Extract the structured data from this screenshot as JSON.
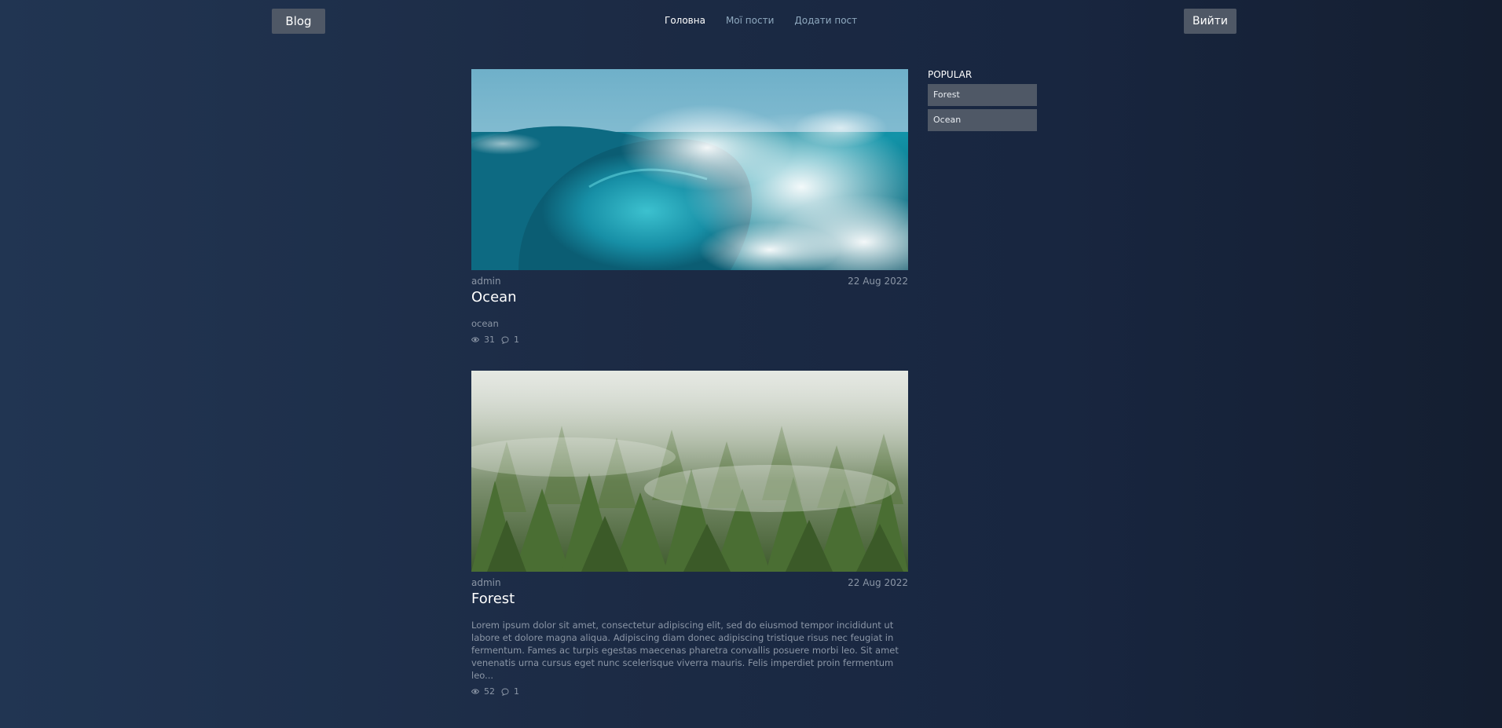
{
  "header": {
    "logo": "Blog",
    "nav": [
      "Головна",
      "Мої пости",
      "Додати пост"
    ],
    "active_nav": "Головна",
    "logout": "Вийти"
  },
  "posts": [
    {
      "author": "admin",
      "date": "22 Aug 2022",
      "title": "Ocean",
      "text": "ocean",
      "views": "31",
      "comments": "1",
      "image": "ocean-wave-photo"
    },
    {
      "author": "admin",
      "date": "22 Aug 2022",
      "title": "Forest",
      "text": "Lorem ipsum dolor sit amet, consectetur adipiscing elit, sed do eiusmod tempor incididunt ut labore et dolore magna aliqua. Adipiscing diam donec adipiscing tristique risus nec feugiat in fermentum. Fames ac turpis egestas maecenas pharetra convallis posuere morbi leo. Sit amet venenatis urna cursus eget nunc scelerisque viverra mauris. Felis imperdiet proin fermentum leo...",
      "views": "52",
      "comments": "1",
      "image": "misty-forest-photo"
    }
  ],
  "sidebar": {
    "heading": "POPULAR",
    "items": [
      "Forest",
      "Ocean"
    ]
  },
  "colors": {
    "button_bg": "#4f5866",
    "nav_inactive": "#8fa9bf",
    "muted_text": "#8b96a6"
  },
  "icons": {
    "views": "eye-icon",
    "comments": "comment-bubble-icon"
  }
}
